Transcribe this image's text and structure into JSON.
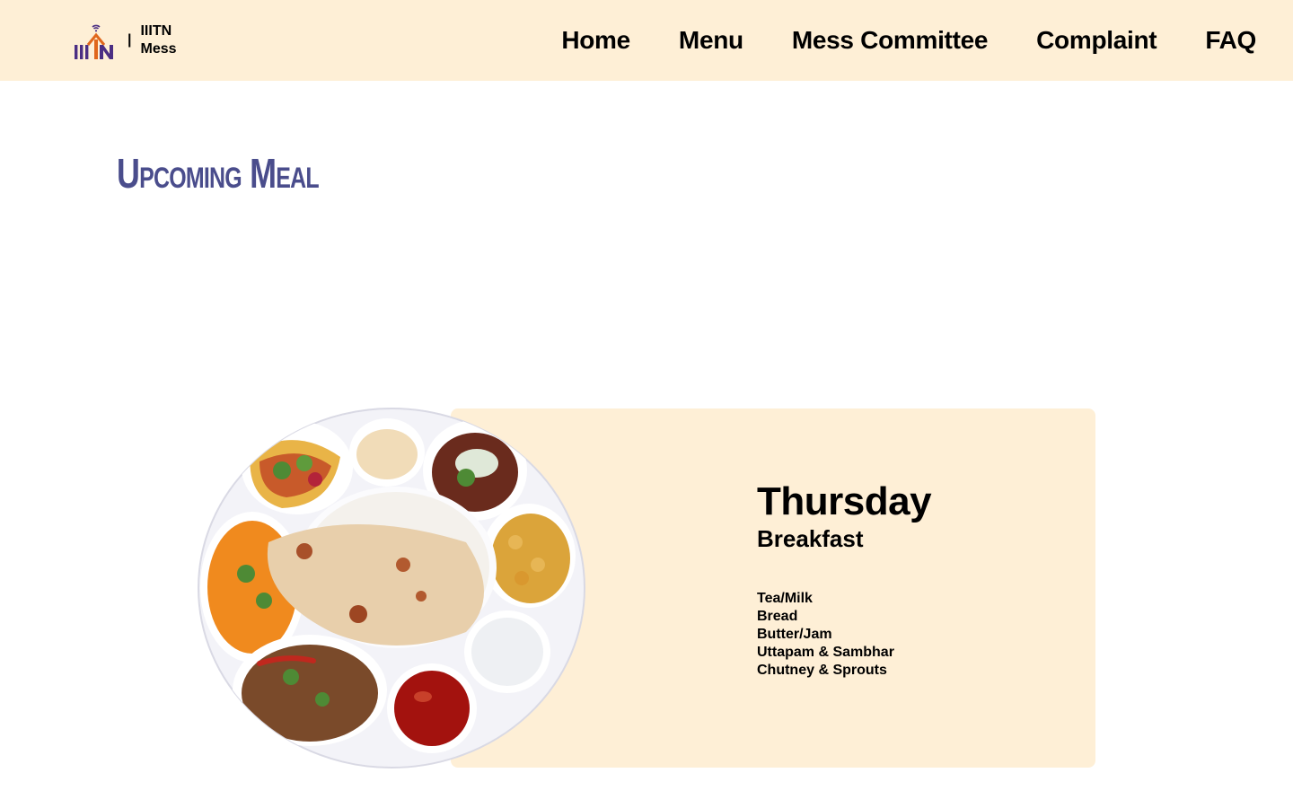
{
  "brand": {
    "separator": "|",
    "line1": "IIITN",
    "line2": "Mess"
  },
  "nav": {
    "items": [
      "Home",
      "Menu",
      "Mess Committee",
      "Complaint",
      "FAQ"
    ]
  },
  "section": {
    "title": "Upcoming Meal"
  },
  "meal": {
    "day": "Thursday",
    "type": "Breakfast",
    "items": [
      "Tea/Milk",
      "Bread",
      "Butter/Jam",
      "Uttapam & Sambhar",
      "Chutney & Sprouts"
    ]
  },
  "colors": {
    "navbar_bg": "#feefd6",
    "card_bg": "#feefd6",
    "title": "#4a4d8c",
    "logo_purple": "#4b2e83",
    "logo_orange": "#e0661b"
  },
  "icons": {
    "logo": "iiitn-logo",
    "plate": "thali-plate-image"
  }
}
